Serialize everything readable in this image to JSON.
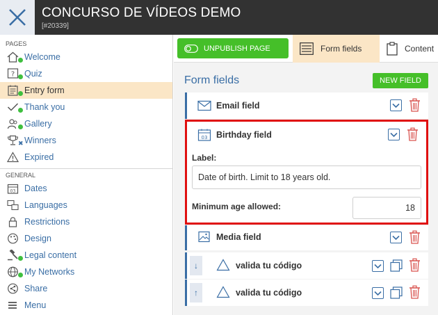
{
  "header": {
    "title": "CONCURSO DE VÍDEOS DEMO",
    "subtitle": "[#20339]",
    "close_icon": "close-x-icon"
  },
  "sidebar": {
    "pages_label": "PAGES",
    "pages": [
      {
        "label": "Welcome",
        "icon": "home-icon",
        "status": "green-dot"
      },
      {
        "label": "Quiz",
        "icon": "question-icon",
        "status": "green-dot"
      },
      {
        "label": "Entry form",
        "icon": "form-icon",
        "status": "green-dot",
        "active": true
      },
      {
        "label": "Thank you",
        "icon": "check-icon",
        "status": "green-dot"
      },
      {
        "label": "Gallery",
        "icon": "users-icon",
        "status": "green-dot"
      },
      {
        "label": "Winners",
        "icon": "trophy-icon",
        "status": "x"
      },
      {
        "label": "Expired",
        "icon": "warning-icon"
      }
    ],
    "general_label": "GENERAL",
    "general": [
      {
        "label": "Dates",
        "icon": "calendar-icon"
      },
      {
        "label": "Languages",
        "icon": "languages-icon"
      },
      {
        "label": "Restrictions",
        "icon": "lock-icon"
      },
      {
        "label": "Design",
        "icon": "palette-icon"
      },
      {
        "label": "Legal content",
        "icon": "gavel-icon",
        "status": "green-dot"
      },
      {
        "label": "My Networks",
        "icon": "network-icon",
        "status": "green-dot"
      },
      {
        "label": "Share",
        "icon": "share-icon"
      },
      {
        "label": "Menu",
        "icon": "menu-icon"
      }
    ]
  },
  "toolbar": {
    "unpublish_label": "UNPUBLISH PAGE",
    "tab_form_fields": "Form fields",
    "tab_content": "Content"
  },
  "main": {
    "heading": "Form fields",
    "new_field_label": "NEW FIELD",
    "fields": [
      {
        "name": "Email field",
        "icon": "email-icon"
      },
      {
        "name": "Birthday field",
        "icon": "calendar-icon",
        "expanded": true,
        "label_caption": "Label:",
        "label_value": "Date of birth. Limit to 18 years old.",
        "min_age_caption": "Minimum age allowed:",
        "min_age_value": "18"
      },
      {
        "name": "Media field",
        "icon": "image-icon"
      },
      {
        "name": "valida tu código",
        "icon": "triangle-icon",
        "arrow": "↓"
      },
      {
        "name": "valida tu código",
        "icon": "triangle-icon",
        "arrow": "↑"
      }
    ]
  },
  "colors": {
    "topbar": "#323232",
    "accent_blue": "#3a6ea5",
    "green": "#45bf29",
    "active_tab": "#fbe6c6",
    "highlight_red": "#e01010",
    "trash_red": "#d9534f"
  }
}
